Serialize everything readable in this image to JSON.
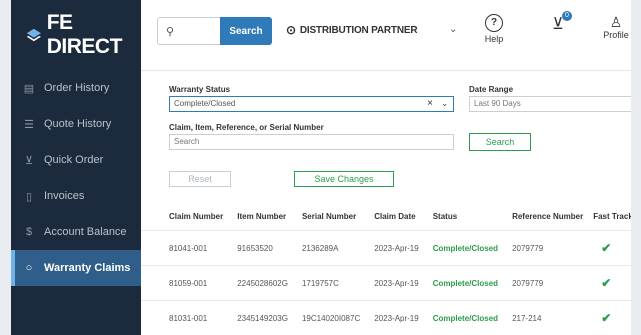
{
  "brand": {
    "name": "FE DIRECT"
  },
  "sidebar": {
    "items": [
      {
        "label": "Order History",
        "icon": "clipboard-icon"
      },
      {
        "label": "Quote History",
        "icon": "document-list-icon"
      },
      {
        "label": "Quick Order",
        "icon": "cart-icon"
      },
      {
        "label": "Invoices",
        "icon": "file-icon"
      },
      {
        "label": "Account Balance",
        "icon": "dollar-icon"
      },
      {
        "label": "Warranty Claims",
        "icon": "circle-icon",
        "active": true
      }
    ]
  },
  "topbar": {
    "search_button": "Search",
    "partner": "DISTRIBUTION PARTNER",
    "help": "Help",
    "cart_count": "0",
    "profile": "Profile"
  },
  "filters": {
    "warranty_status_label": "Warranty Status",
    "warranty_status_value": "Complete/Closed",
    "date_range_label": "Date Range",
    "date_range_value": "Last 90 Days",
    "claim_search_label": "Claim, Item, Reference, or Serial Number",
    "claim_search_placeholder": "Search",
    "search_button": "Search",
    "reset_button": "Reset",
    "save_button": "Save Changes"
  },
  "table": {
    "headers": [
      "Claim Number",
      "Item Number",
      "Serial Number",
      "Claim Date",
      "Status",
      "Reference Number",
      "Fast TrackAction"
    ],
    "rows": [
      [
        "81041-001",
        "91653520",
        "2136289A",
        "2023-Apr-19",
        "Complete/Closed",
        "2079779",
        "✔"
      ],
      [
        "81059-001",
        "2245028602G",
        "1719757C",
        "2023-Apr-19",
        "Complete/Closed",
        "2079779",
        "✔"
      ],
      [
        "81031-001",
        "2345149203G",
        "19C14020I087C",
        "2023-Apr-19",
        "Complete/Closed",
        "217-214",
        "✔"
      ]
    ]
  },
  "colors": {
    "sidebar": "#1b2a3c",
    "accent": "#2f7ab8",
    "success": "#2e9c4c"
  }
}
